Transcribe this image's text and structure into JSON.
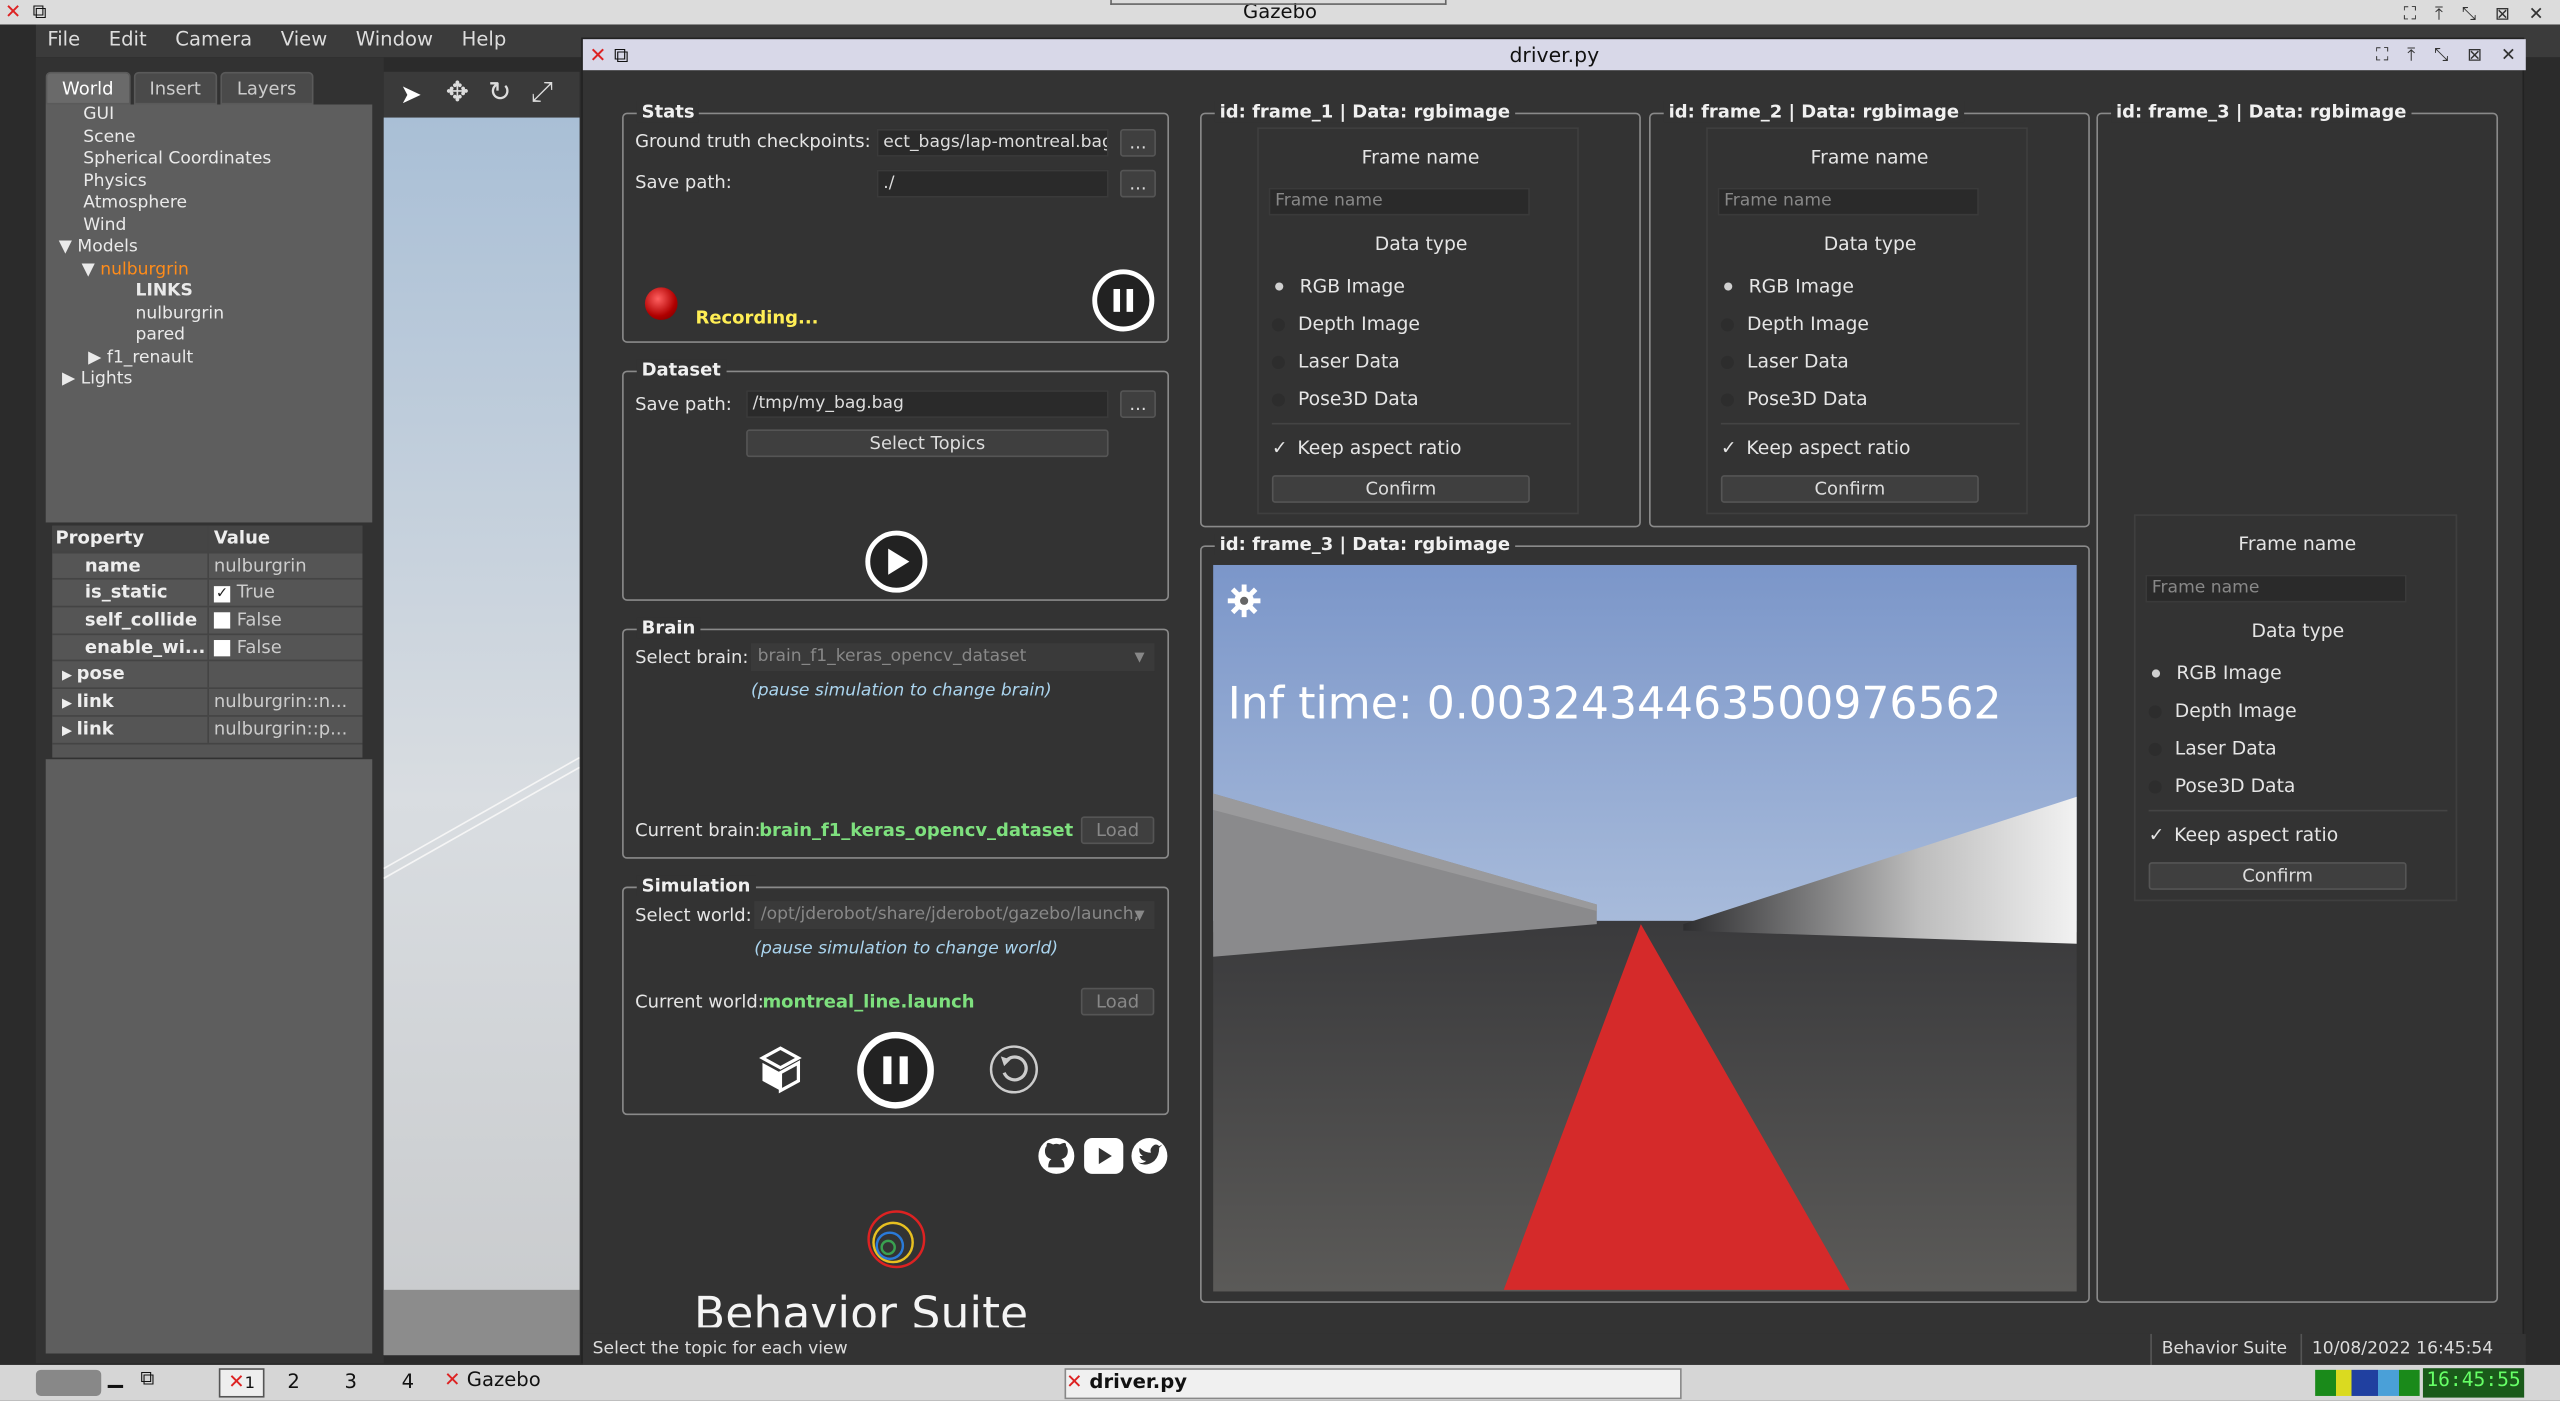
{
  "gazebo": {
    "window_title": "Gazebo",
    "menu": [
      "File",
      "Edit",
      "Camera",
      "View",
      "Window",
      "Help"
    ],
    "tabs": [
      "World",
      "Insert",
      "Layers"
    ],
    "tree": [
      "GUI",
      "Scene",
      "Spherical Coordinates",
      "Physics",
      "Atmosphere",
      "Wind",
      "Models",
      "nulburgrin",
      "LINKS",
      "nulburgrin",
      "pared",
      "f1_renault",
      "Lights"
    ],
    "props_header": [
      "Property",
      "Value"
    ],
    "props": [
      {
        "k": "name",
        "v": "nulburgrin"
      },
      {
        "k": "is_static",
        "v": "True"
      },
      {
        "k": "self_collide",
        "v": "False"
      },
      {
        "k": "enable_wi...",
        "v": "False"
      },
      {
        "k": "pose",
        "v": ""
      },
      {
        "k": "link",
        "v": "nulburgrin::n..."
      },
      {
        "k": "link",
        "v": "nulburgrin::p..."
      }
    ]
  },
  "driver": {
    "window_title": "driver.py",
    "stats": {
      "title": "Stats",
      "gt_label": "Ground truth checkpoints:",
      "gt_value": "ect_bags/lap-montreal.bag",
      "save_label": "Save path:",
      "save_value": "./",
      "browse": "...",
      "recording": "Recording..."
    },
    "dataset": {
      "title": "Dataset",
      "save_label": "Save path:",
      "save_value": "/tmp/my_bag.bag",
      "browse": "...",
      "select_topics": "Select Topics"
    },
    "brain": {
      "title": "Brain",
      "select_label": "Select brain:",
      "select_value": "brain_f1_keras_opencv_dataset",
      "hint": "(pause simulation to change brain)",
      "current_label": "Current brain:",
      "current_value": "brain_f1_keras_opencv_dataset",
      "load": "Load"
    },
    "simulation": {
      "title": "Simulation",
      "select_label": "Select world:",
      "select_value": "/opt/jderobot/share/jderobot/gazebo/launch,",
      "hint": "(pause simulation to change world)",
      "current_label": "Current world:",
      "current_value": "montreal_line.launch",
      "load": "Load"
    },
    "brand": "Behavior Suite",
    "frames": [
      {
        "title": "id:  frame_1 | Data:  rgbimage"
      },
      {
        "title": "id:  frame_2 | Data:  rgbimage"
      },
      {
        "title": "id:  frame_3 | Data:  rgbimage"
      },
      {
        "title": "id:  frame_3 | Data:  rgbimage"
      }
    ],
    "frame_form": {
      "name_heading": "Frame name",
      "name_placeholder": "Frame name",
      "type_heading": "Data type",
      "options": [
        "RGB Image",
        "Depth Image",
        "Laser Data",
        "Pose3D Data"
      ],
      "keep_aspect": "Keep aspect ratio",
      "confirm": "Confirm"
    },
    "inf_time": "Inf time: 0.0032434463500976562",
    "status_message": "Select the topic for each view",
    "status_app": "Behavior Suite",
    "status_datetime": "10/08/2022 16:45:54"
  },
  "taskbar": {
    "desktops": [
      "1",
      "2",
      "3",
      "4"
    ],
    "tasks": [
      "Gazebo",
      "driver.py"
    ],
    "clock": "16:45:55"
  },
  "colors": {
    "track_red": "#d52a2a",
    "recording_yellow": "#ffee55",
    "green_value": "#7ee07e",
    "sky": "#7b96c9"
  }
}
